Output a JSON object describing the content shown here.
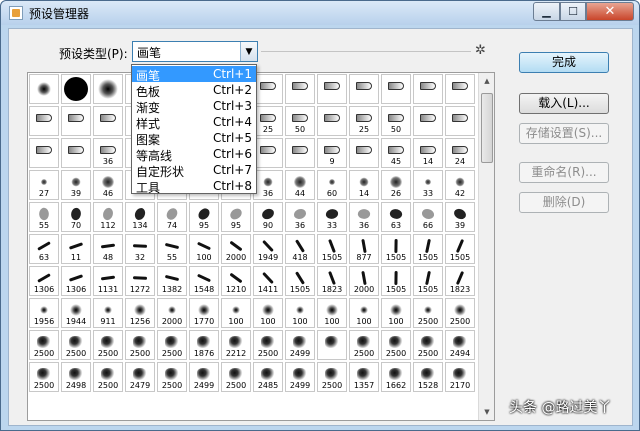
{
  "window": {
    "title": "预设管理器",
    "min_symbol": "▁",
    "max_symbol": "☐",
    "close_symbol": "✕"
  },
  "header": {
    "type_label": "预设类型(P):",
    "selected_type": "画笔",
    "dropdown_arrow": "▼",
    "gear_symbol": "✲"
  },
  "buttons": {
    "done": "完成",
    "load": "载入(L)...",
    "save_set": "存储设置(S)...",
    "rename": "重命名(R)...",
    "delete": "删除(D)"
  },
  "dropdown": {
    "items": [
      {
        "name": "画笔",
        "shortcut": "Ctrl+1"
      },
      {
        "name": "色板",
        "shortcut": "Ctrl+2"
      },
      {
        "name": "渐变",
        "shortcut": "Ctrl+3"
      },
      {
        "name": "样式",
        "shortcut": "Ctrl+4"
      },
      {
        "name": "图案",
        "shortcut": "Ctrl+5"
      },
      {
        "name": "等高线",
        "shortcut": "Ctrl+6"
      },
      {
        "name": "自定形状",
        "shortcut": "Ctrl+7"
      },
      {
        "name": "工具",
        "shortcut": "Ctrl+8"
      }
    ]
  },
  "presets": {
    "rows": [
      [
        "",
        "",
        "",
        "",
        "",
        "",
        "",
        "",
        "",
        "",
        "",
        "",
        "",
        ""
      ],
      [
        "",
        "",
        "",
        "",
        "",
        "",
        "",
        "25",
        "50",
        "",
        "25",
        "50",
        "",
        ""
      ],
      [
        "",
        "",
        "36",
        "",
        "",
        "",
        "",
        "",
        "",
        "9",
        "",
        "45",
        "14",
        "24"
      ],
      [
        "27",
        "39",
        "46",
        "",
        "",
        "",
        "",
        "36",
        "44",
        "60",
        "14",
        "26",
        "33",
        "42"
      ],
      [
        "55",
        "70",
        "112",
        "134",
        "74",
        "95",
        "95",
        "90",
        "36",
        "33",
        "36",
        "63",
        "66",
        "39"
      ],
      [
        "63",
        "11",
        "48",
        "32",
        "55",
        "100",
        "2000",
        "1949",
        "418",
        "1505",
        "877",
        "1505",
        "1505",
        "1505"
      ],
      [
        "1306",
        "1306",
        "1131",
        "1272",
        "1382",
        "1548",
        "1210",
        "1411",
        "1505",
        "1823",
        "2000",
        "1505",
        "1505",
        "1823"
      ],
      [
        "1956",
        "1944",
        "911",
        "1256",
        "2000",
        "1770",
        "100",
        "100",
        "100",
        "100",
        "100",
        "100",
        "2500",
        "2500"
      ],
      [
        "2500",
        "2500",
        "2500",
        "2500",
        "2500",
        "1876",
        "2212",
        "2500",
        "2499",
        "",
        "2500",
        "2500",
        "2500",
        "2494"
      ],
      [
        "2500",
        "2498",
        "2500",
        "2479",
        "2500",
        "2499",
        "2500",
        "2485",
        "2499",
        "2500",
        "1357",
        "1662",
        "1528",
        "2170"
      ]
    ]
  },
  "watermark": "头条 @路过美丫",
  "colors": {
    "selection": "#3399ff",
    "title_bar": "#bcd6ee",
    "close_button": "#c9452a"
  }
}
